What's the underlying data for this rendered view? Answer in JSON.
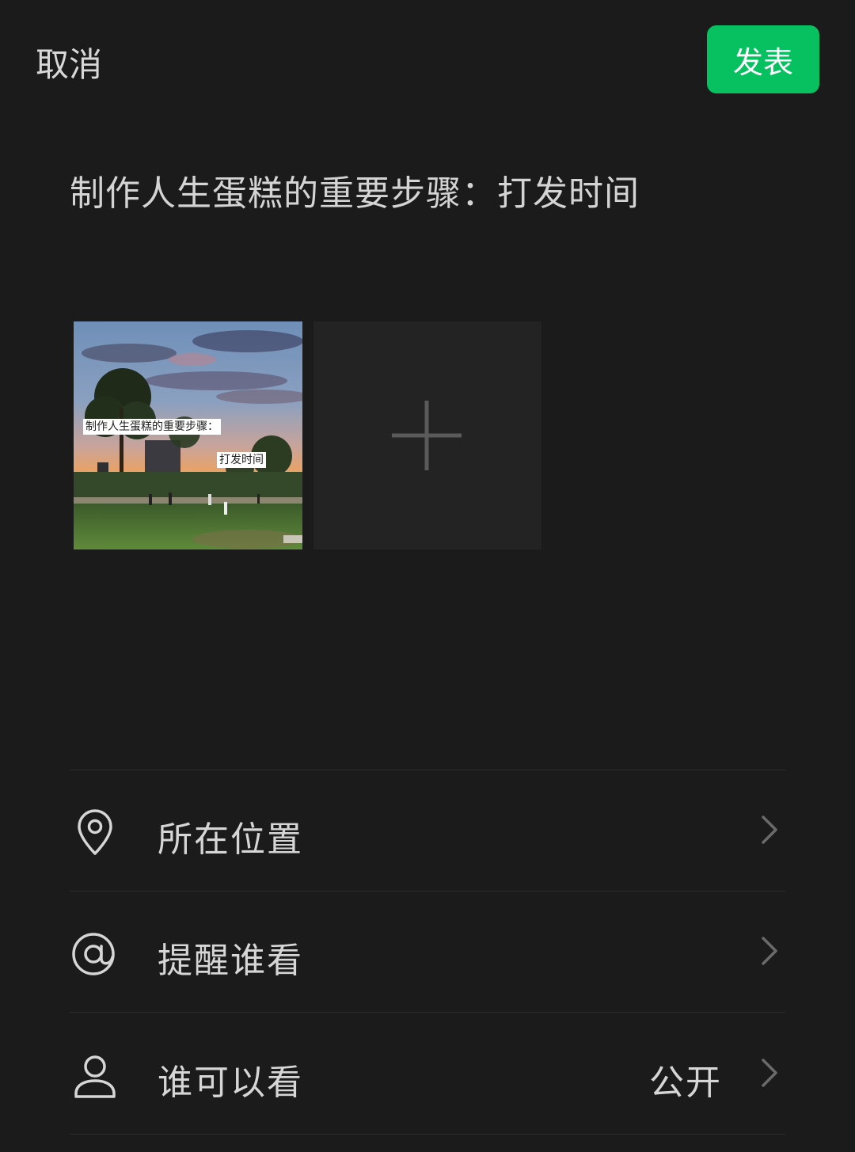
{
  "header": {
    "cancel_label": "取消",
    "publish_label": "发表",
    "accent_color": "#07c160"
  },
  "post": {
    "text": "制作人生蛋糕的重要步骤：打发时间"
  },
  "media": {
    "photo": {
      "caption_line1": "制作人生蛋糕的重要步骤：",
      "caption_line2": "打发时间"
    },
    "add_icon": "plus-icon"
  },
  "options": [
    {
      "icon": "location-pin-icon",
      "label": "所在位置",
      "value": ""
    },
    {
      "icon": "at-icon",
      "label": "提醒谁看",
      "value": ""
    },
    {
      "icon": "person-icon",
      "label": "谁可以看",
      "value": "公开"
    }
  ]
}
